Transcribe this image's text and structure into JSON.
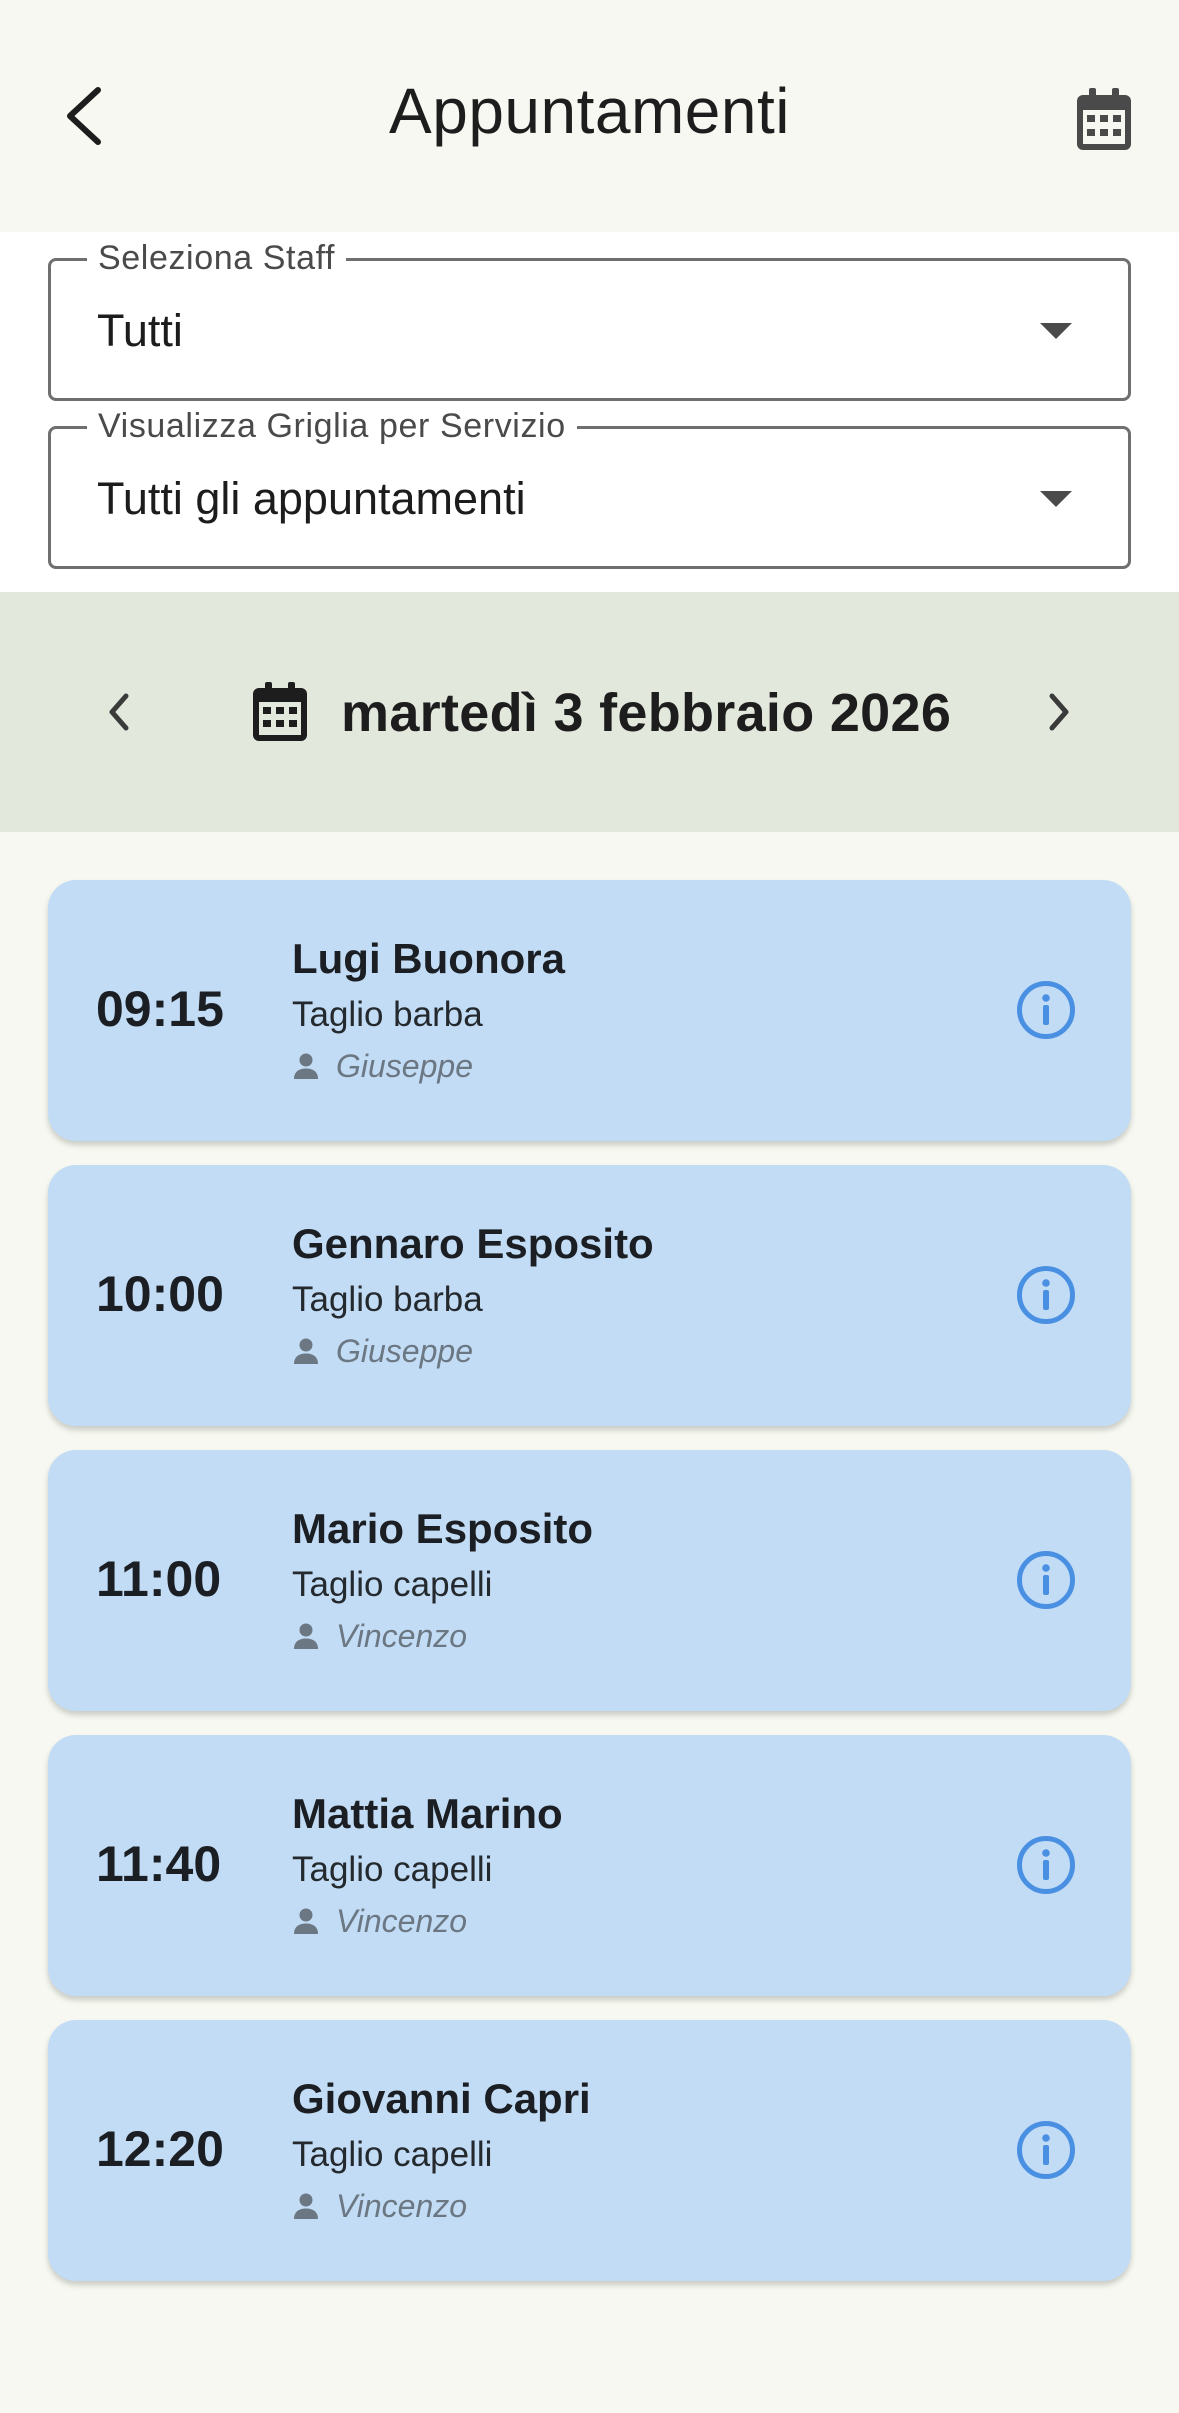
{
  "header": {
    "title": "Appuntamenti",
    "back_icon": "back-arrow-icon",
    "calendar_icon": "calendar-icon"
  },
  "filters": {
    "staff": {
      "label": "Seleziona Staff",
      "value": "Tutti"
    },
    "service": {
      "label": "Visualizza Griglia per Servizio",
      "value": "Tutti gli appuntamenti"
    }
  },
  "date_nav": {
    "date": "martedì 3 febbraio 2026",
    "prev_icon": "chevron-left-icon",
    "next_icon": "chevron-right-icon"
  },
  "colors": {
    "background": "#f6f8f1",
    "date_bar": "#e3e8dd",
    "card": "#c2dcf5",
    "info_accent": "#4a90e2"
  },
  "appointments": [
    {
      "time": "09:15",
      "client": "Lugi Buonora",
      "service": "Taglio barba",
      "staff": "Giuseppe"
    },
    {
      "time": "10:00",
      "client": "Gennaro Esposito",
      "service": "Taglio barba",
      "staff": "Giuseppe"
    },
    {
      "time": "11:00",
      "client": "Mario Esposito",
      "service": "Taglio capelli",
      "staff": "Vincenzo"
    },
    {
      "time": "11:40",
      "client": "Mattia Marino",
      "service": "Taglio capelli",
      "staff": "Vincenzo"
    },
    {
      "time": "12:20",
      "client": "Giovanni Capri",
      "service": "Taglio capelli",
      "staff": "Vincenzo"
    }
  ]
}
